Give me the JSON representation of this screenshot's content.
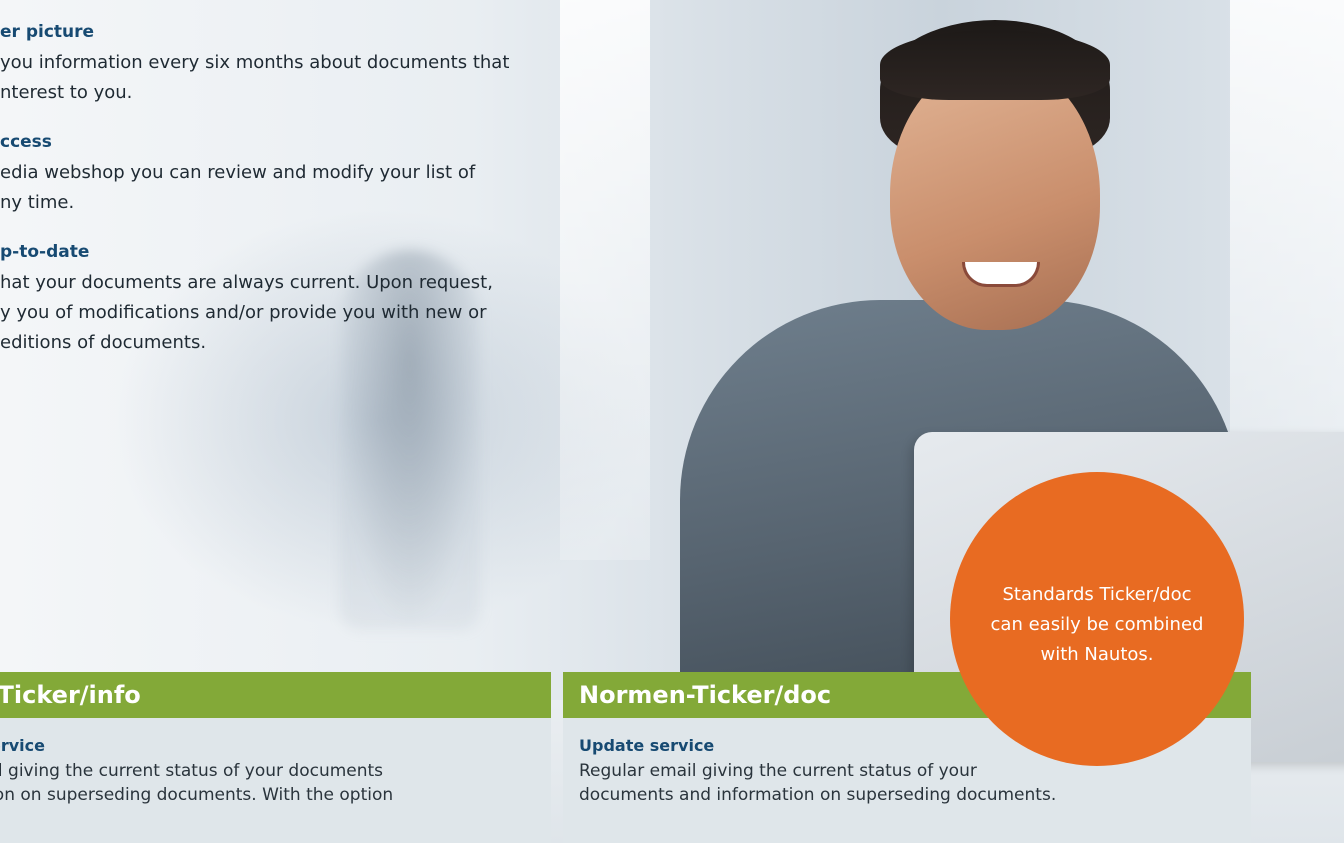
{
  "features": [
    {
      "title": "er picture",
      "text": " you information every six months about documents that\nnterest to you."
    },
    {
      "title": "ccess",
      "text": "edia webshop you can review and modify your list of\nny time."
    },
    {
      "title": "p-to-date",
      "text": "hat your documents are always current. Upon request,\ny you of modifications and/or provide you with new or\n editions of documents."
    }
  ],
  "cards": [
    {
      "title": "n-Ticker/info",
      "subtitle": "ervice",
      "body": "nail giving the current status of your documents\nation on superseding documents. With the option"
    },
    {
      "title": "Normen-Ticker/doc",
      "subtitle": "Update service",
      "body": "Regular email giving the current status of your\ndocuments and information on superseding documents."
    }
  ],
  "badge": {
    "text": "Standards Ticker/doc\ncan easily be combined\nwith Nautos.",
    "color": "#e86b22"
  },
  "colors": {
    "header_green": "#83a938",
    "title_blue": "#174a72",
    "card_bg": "#dfe6ea"
  }
}
